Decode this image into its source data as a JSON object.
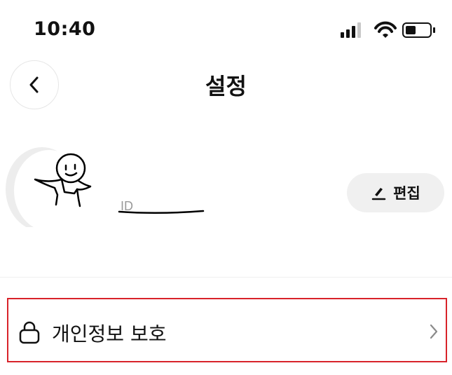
{
  "status_bar": {
    "time": "10:40"
  },
  "header": {
    "title": "설정",
    "back_icon": "chevron-left-icon"
  },
  "profile": {
    "id_placeholder": "ID",
    "edit_label": "편집",
    "edit_icon": "pencil-icon"
  },
  "menu": {
    "items": [
      {
        "label": "개인정보 보호",
        "icon": "lock-icon",
        "chevron": "chevron-right-icon"
      }
    ]
  },
  "colors": {
    "highlight_border": "#d8232a",
    "button_bg": "#f0f0f0",
    "text": "#111111",
    "muted": "#9a9a9a"
  }
}
